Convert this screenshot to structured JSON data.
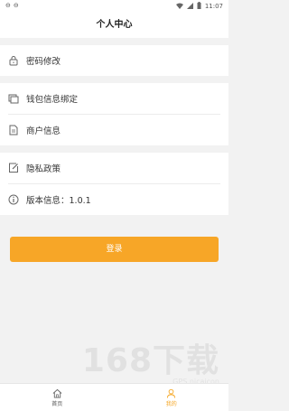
{
  "status_bar": {
    "time": "11:07"
  },
  "header": {
    "title": "个人中心"
  },
  "menu": {
    "password": "密码修改",
    "wallet": "钱包信息绑定",
    "merchant": "商户信息",
    "privacy": "隐私政策",
    "version": "版本信息：1.0.1"
  },
  "login_button": "登录",
  "tabbar": {
    "home": "首页",
    "mine": "我的"
  },
  "watermark": {
    "main": "168下载",
    "sub": "GPS.nicaicon"
  },
  "colors": {
    "accent": "#f7a627",
    "background": "#f2f2f2"
  }
}
